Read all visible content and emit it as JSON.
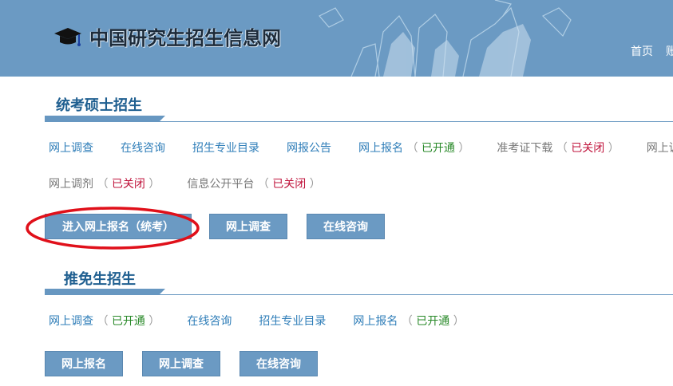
{
  "header": {
    "site_title": "中国研究生招生信息网",
    "nav": [
      "首页",
      "账"
    ]
  },
  "tongkao": {
    "title": "统考硕士招生",
    "links": [
      {
        "label": "网上调查",
        "status": "",
        "state": "blue"
      },
      {
        "label": "在线咨询",
        "status": "",
        "state": "blue"
      },
      {
        "label": "招生专业目录",
        "status": "",
        "state": "blue"
      },
      {
        "label": "网报公告",
        "status": "",
        "state": "blue"
      },
      {
        "label": "网上报名",
        "status": "已开通",
        "state": "blue"
      },
      {
        "label": "准考证下载",
        "status": "已关闭",
        "state": "gray"
      },
      {
        "label": "网上调剂",
        "status": "",
        "state": "gray"
      }
    ],
    "links_row2": [
      {
        "label": "网上调剂",
        "status": "已关闭",
        "state": "gray"
      },
      {
        "label": "信息公开平台",
        "status": "已关闭",
        "state": "gray"
      }
    ],
    "buttons": [
      "进入网上报名（统考）",
      "网上调查",
      "在线咨询"
    ]
  },
  "tuimian": {
    "title": "推免生招生",
    "links": [
      {
        "label": "网上调查",
        "status": "已开通",
        "state": "blue"
      },
      {
        "label": "在线咨询",
        "status": "",
        "state": "blue"
      },
      {
        "label": "招生专业目录",
        "status": "",
        "state": "blue"
      },
      {
        "label": "网上报名",
        "status": "已开通",
        "state": "blue"
      }
    ],
    "buttons": [
      "网上报名",
      "网上调查",
      "在线咨询"
    ]
  },
  "colors": {
    "header_bg": "#6b9ac3",
    "accent": "#1f5f90",
    "link": "#2e7db8",
    "open": "#2a8a2a",
    "closed": "#c0143c",
    "highlight": "#e0101a"
  }
}
